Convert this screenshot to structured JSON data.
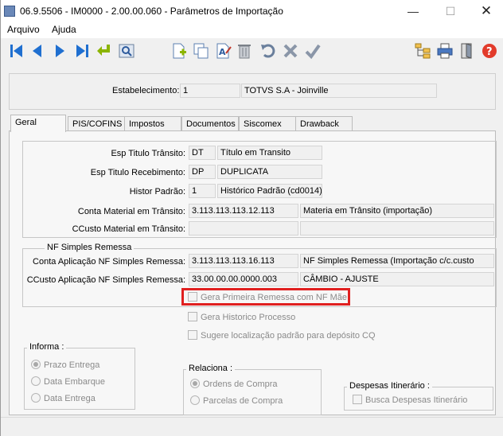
{
  "window": {
    "title": "06.9.5506 - IM0000 - 2.00.00.060 - Parâmetros de Importação",
    "minimize": "—",
    "maximize": "☐",
    "close": "✕"
  },
  "menu": {
    "arquivo": "Arquivo",
    "ajuda": "Ajuda"
  },
  "toolbar": {
    "icons": [
      "first-icon",
      "prev-icon",
      "next-icon",
      "last-icon",
      "goto-icon",
      "search-icon",
      "new-icon",
      "copy-icon",
      "edit-icon",
      "delete-icon",
      "undo-icon",
      "cancel-icon",
      "confirm-icon",
      "tree-icon",
      "print-icon",
      "exit-icon",
      "help-icon"
    ]
  },
  "header": {
    "estabelecimento_label": "Estabelecimento:",
    "estabelecimento_code": "1",
    "estabelecimento_name": "TOTVS S.A - Joinville"
  },
  "tabs": [
    {
      "label": "Geral",
      "active": true
    },
    {
      "label": "PIS/COFINS"
    },
    {
      "label": "Impostos"
    },
    {
      "label": "Documentos"
    },
    {
      "label": "Siscomex"
    },
    {
      "label": "Drawback"
    }
  ],
  "geral": {
    "esp_titulo_transito": {
      "label": "Esp Titulo Trânsito:",
      "code": "DT",
      "desc": "Título em Transito"
    },
    "esp_titulo_recebimento": {
      "label": "Esp Titulo Recebimento:",
      "code": "DP",
      "desc": "DUPLICATA"
    },
    "histor_padrao": {
      "label": "Histor Padrão:",
      "code": "1",
      "desc": "Histórico Padrão (cd0014)"
    },
    "conta_material_transito": {
      "label": "Conta Material em Trânsito:",
      "code": "3.113.113.113.12.113",
      "desc": "Materia em Trânsito (importação)"
    },
    "ccusto_material_transito": {
      "label": "CCusto Material em Trânsito:",
      "code": "",
      "desc": ""
    },
    "nf_simples": {
      "title": "NF Simples Remessa",
      "conta_label": "Conta Aplicação NF Simples Remessa:",
      "conta_code": "3.113.113.113.16.113",
      "conta_desc": "NF Simples Remessa (Importação c/c.custo",
      "ccusto_label": "CCusto Aplicação NF Simples Remessa:",
      "ccusto_code": "33.00.00.00.0000.003",
      "ccusto_desc": "CÂMBIO - AJUSTE"
    },
    "checkboxes": {
      "gera_primeira_remessa": "Gera Primeira Remessa com NF Mãe",
      "gera_historico": "Gera Historico Processo",
      "sugere_localizacao": "Sugere localização padrão para depósito CQ"
    },
    "informa": {
      "title": "Informa :",
      "options": [
        "Prazo Entrega",
        "Data  Embarque",
        "Data  Entrega"
      ],
      "selected": "Prazo Entrega"
    },
    "relaciona": {
      "title": "Relaciona :",
      "options": [
        "Ordens de Compra",
        "Parcelas de Compra"
      ],
      "selected": "Ordens de Compra"
    },
    "despesas": {
      "title": "Despesas Itinerário :",
      "checkbox": "Busca Despesas Itinerário"
    }
  },
  "colors": {
    "highlight": "#e02020",
    "toolbar_blue": "#1f6fd0",
    "toolbar_green": "#8bb400"
  }
}
